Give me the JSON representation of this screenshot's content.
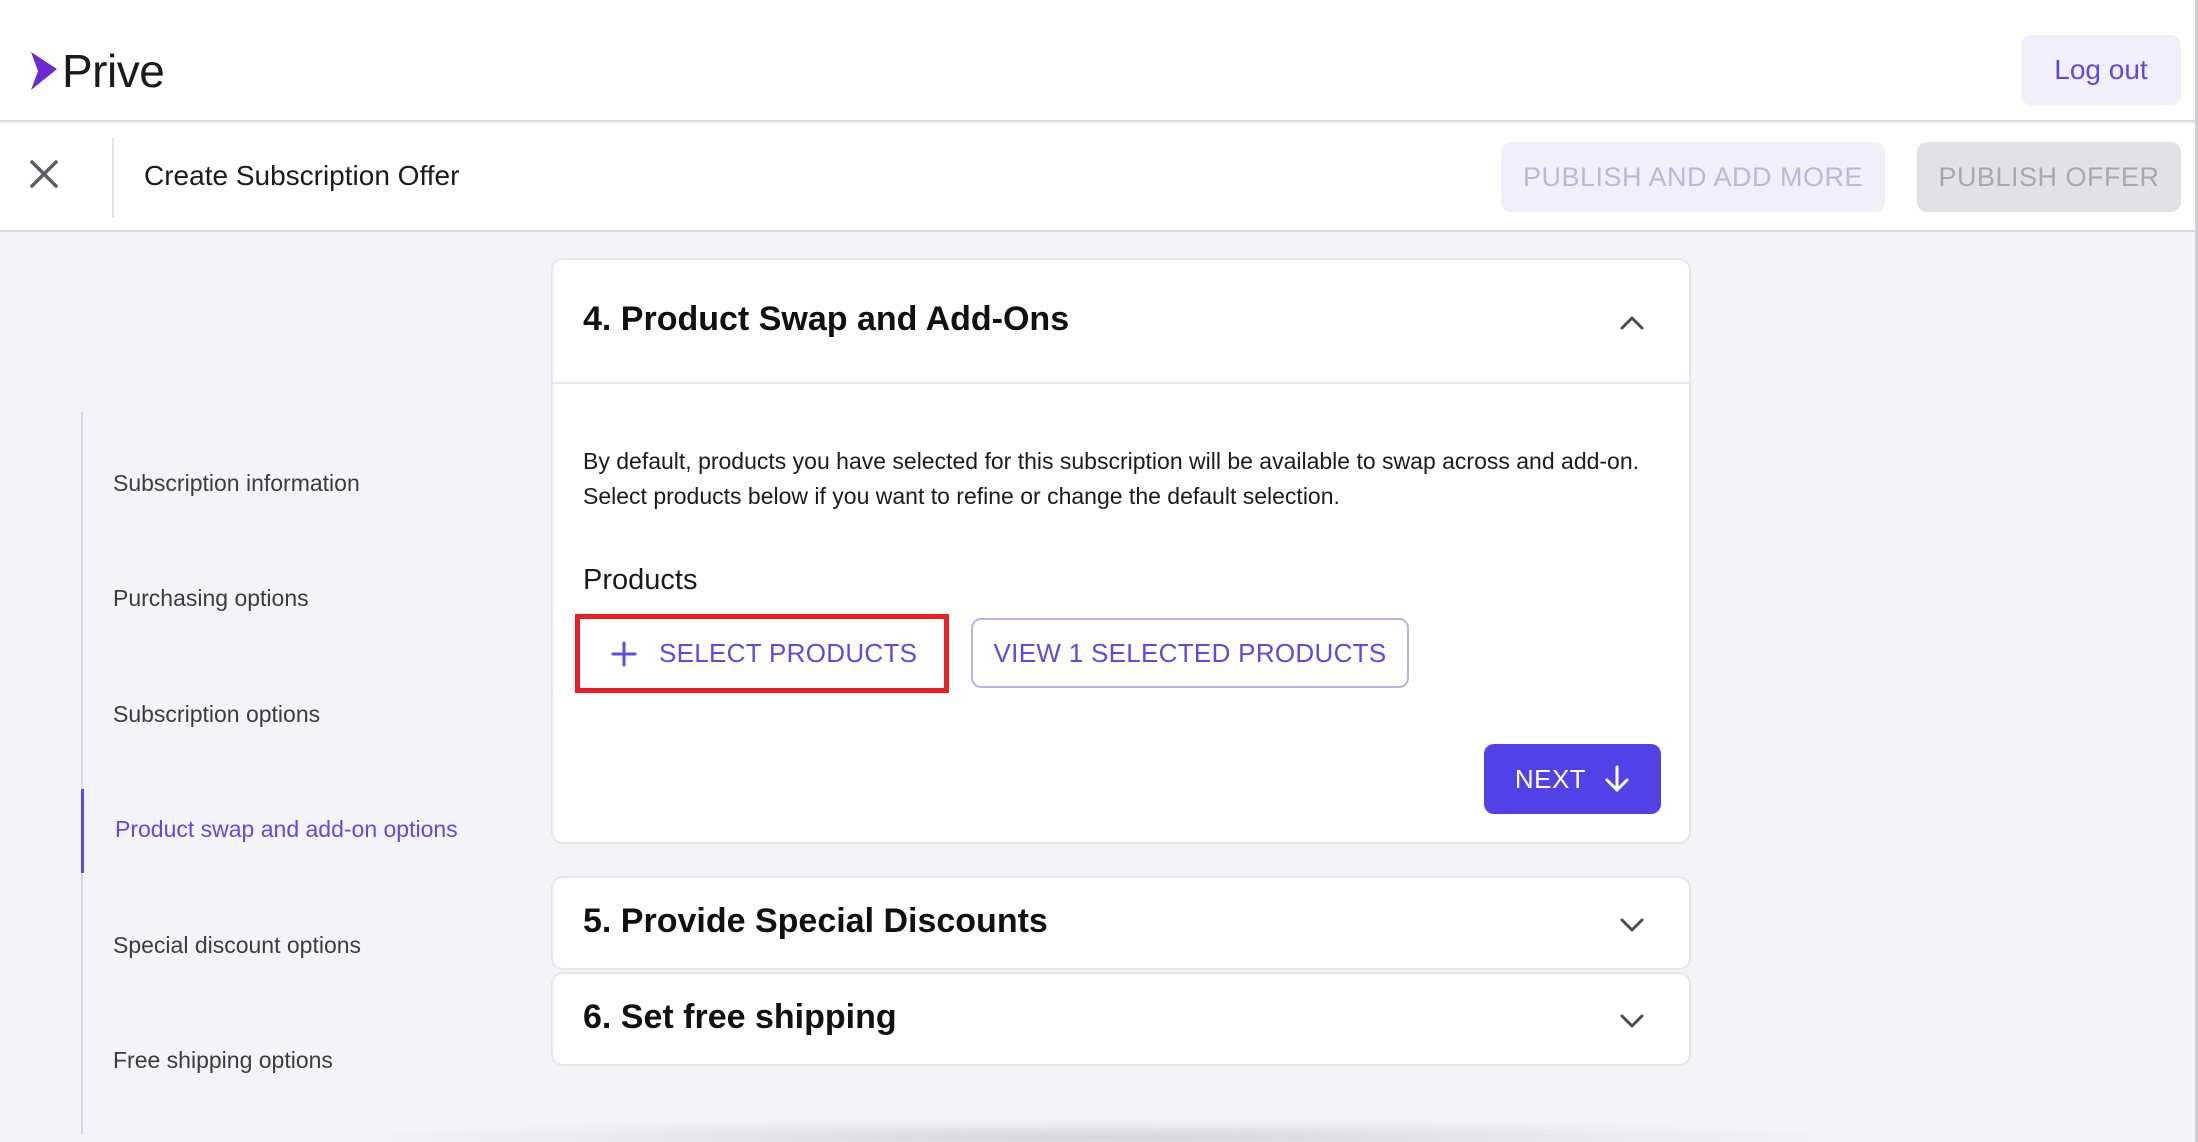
{
  "app": {
    "name": "Prive",
    "brand_color": "#5b4be1",
    "logout_label": "Log out"
  },
  "subbar": {
    "title": "Create Subscription Offer",
    "publish_more_label": "PUBLISH AND ADD MORE",
    "publish_offer_label": "PUBLISH OFFER"
  },
  "sidebar": {
    "items": [
      {
        "label": "Subscription information",
        "active": false
      },
      {
        "label": "Purchasing options",
        "active": false
      },
      {
        "label": "Subscription options",
        "active": false
      },
      {
        "label": "Product swap and add-on options",
        "active": true
      },
      {
        "label": "Special discount options",
        "active": false
      },
      {
        "label": "Free shipping options",
        "active": false
      }
    ]
  },
  "sections": {
    "swap": {
      "title": "4. Product Swap and Add-Ons",
      "description": "By default, products you have selected for this subscription will be available to swap across and add-on. Select products below if you want to refine or change the default selection.",
      "products_label": "Products",
      "select_label": "SELECT PRODUCTS",
      "view_label": "VIEW 1 SELECTED PRODUCTS",
      "next_label": "NEXT"
    },
    "discounts": {
      "title": "5. Provide Special Discounts"
    },
    "shipping": {
      "title": "6. Set free shipping"
    }
  },
  "icons": {
    "logo": "prive-arrow-logo",
    "close": "close-icon",
    "collapse": "chevron-up-icon",
    "expand": "chevron-down-icon",
    "add": "plus-icon",
    "next": "arrow-down-icon"
  },
  "colors": {
    "highlight": "#ec1d24",
    "primary_button": "#5241e6"
  }
}
